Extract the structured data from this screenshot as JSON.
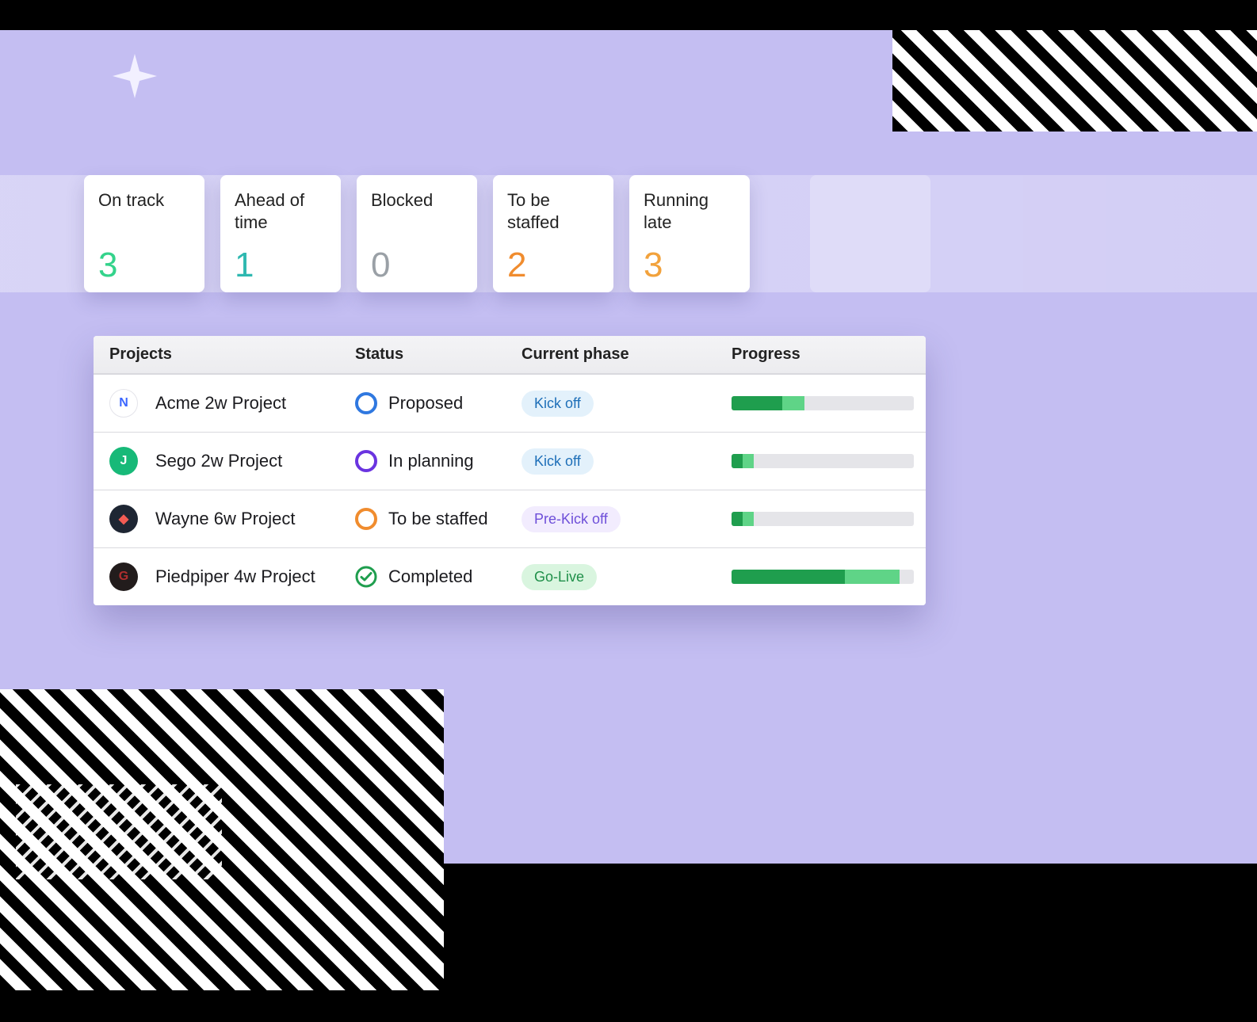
{
  "summary_cards": [
    {
      "label": "On track",
      "count": 3,
      "color_class": "c-green"
    },
    {
      "label": "Ahead of time",
      "count": 1,
      "color_class": "c-teal"
    },
    {
      "label": "Blocked",
      "count": 0,
      "color_class": "c-gray"
    },
    {
      "label": "To be staffed",
      "count": 2,
      "color_class": "c-orange"
    },
    {
      "label": "Running late",
      "count": 3,
      "color_class": "c-orange2"
    }
  ],
  "table": {
    "headers": {
      "projects": "Projects",
      "status": "Status",
      "phase": "Current phase",
      "progress": "Progress"
    },
    "rows": [
      {
        "logo_letter": "N",
        "logo_bg": "outline",
        "logo_color": "#3b66ff",
        "name": "Acme 2w Project",
        "status_label": "Proposed",
        "status_ring_color": "#2F78E0",
        "status_kind": "ring",
        "phase_label": "Kick off",
        "phase_class": "pill-kick",
        "progress_dark_pct": 28,
        "progress_light_pct": 12
      },
      {
        "logo_letter": "J",
        "logo_bg": "#17B978",
        "logo_color": "#ffffff",
        "name": "Sego 2w Project",
        "status_label": "In planning",
        "status_ring_color": "#6A34E0",
        "status_kind": "ring",
        "phase_label": "Kick off",
        "phase_class": "pill-kick",
        "progress_dark_pct": 6,
        "progress_light_pct": 6
      },
      {
        "logo_letter": "◆",
        "logo_bg": "#1E2633",
        "logo_color": "#F25C54",
        "name": "Wayne 6w Project",
        "status_label": "To be staffed",
        "status_ring_color": "#F08C2E",
        "status_kind": "ring",
        "phase_label": "Pre-Kick off",
        "phase_class": "pill-pre",
        "progress_dark_pct": 6,
        "progress_light_pct": 6
      },
      {
        "logo_letter": "G",
        "logo_bg": "#221C1C",
        "logo_color": "#B02E2E",
        "name": "Piedpiper 4w Project",
        "status_label": "Completed",
        "status_ring_color": "#1F9E4E",
        "status_kind": "check",
        "phase_label": "Go-Live",
        "phase_class": "pill-golive",
        "progress_dark_pct": 62,
        "progress_light_pct": 30
      }
    ]
  }
}
